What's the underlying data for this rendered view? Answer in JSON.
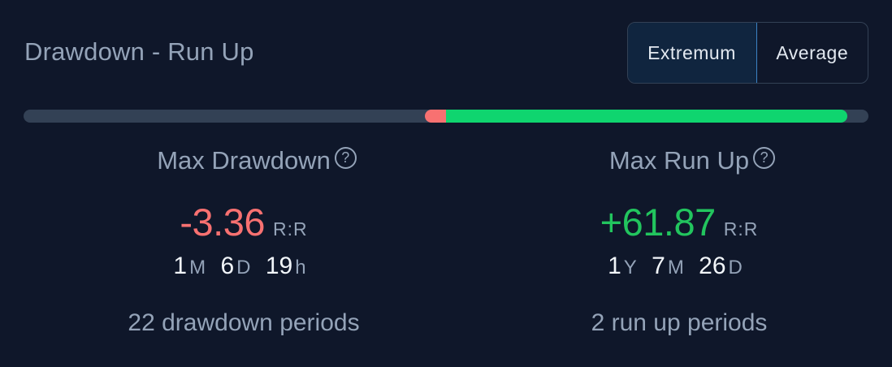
{
  "header": {
    "title": "Drawdown - Run Up",
    "toggle": {
      "active": "Extremum",
      "inactive": "Average"
    }
  },
  "progress": {
    "drawdown_fraction": 0.027,
    "runup_fraction": 0.475,
    "drawdown_color": "#f87171",
    "runup_color": "#0fd56f"
  },
  "drawdown": {
    "label": "Max Drawdown",
    "help": "?",
    "value": "-3.36",
    "unit": "R:R",
    "duration": [
      {
        "n": "1",
        "u": "M"
      },
      {
        "n": "6",
        "u": "D"
      },
      {
        "n": "19",
        "u": "h"
      }
    ],
    "periods": "22 drawdown periods"
  },
  "runup": {
    "label": "Max Run Up",
    "help": "?",
    "value": "+61.87",
    "unit": "R:R",
    "duration": [
      {
        "n": "1",
        "u": "Y"
      },
      {
        "n": "7",
        "u": "M"
      },
      {
        "n": "26",
        "u": "D"
      }
    ],
    "periods": "2 run up periods"
  }
}
